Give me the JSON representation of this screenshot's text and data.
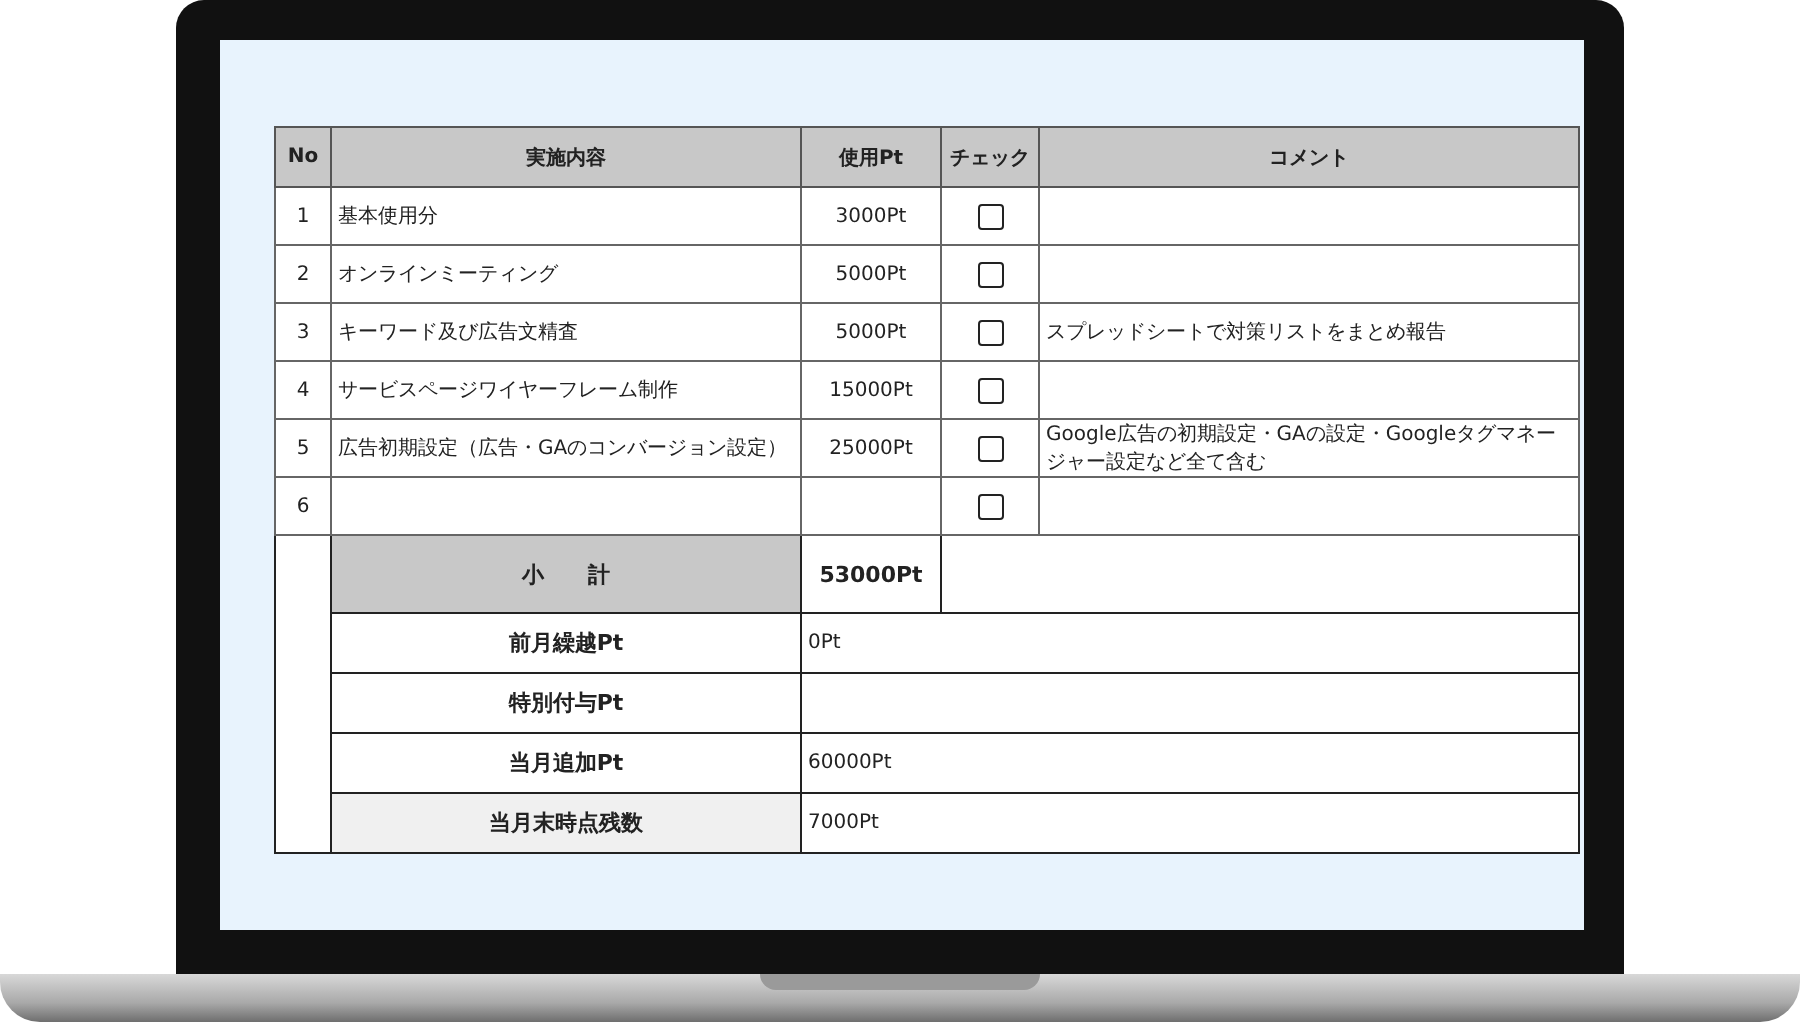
{
  "table": {
    "columns": [
      "No",
      "実施内容",
      "使用Pt",
      "チェック",
      "コメント"
    ],
    "rows": [
      {
        "no": "1",
        "item": "基本使用分",
        "points": "3000Pt",
        "checked": false
      },
      {
        "no": "2",
        "item": "オンラインミーティング",
        "points": "5000Pt",
        "checked": false
      },
      {
        "no": "3",
        "item": "キーワード及び広告文精査",
        "points": "5000Pt",
        "checked": false,
        "comment": "スプレッドシートで対策リストをまとめ報告"
      },
      {
        "no": "4",
        "item": "サービスページワイヤーフレーム制作",
        "points": "15000Pt",
        "checked": false
      },
      {
        "no": "5",
        "item": "広告初期設定（広告・GAのコンバージョン設定）",
        "points": "25000Pt",
        "checked": false,
        "comment": "Google広告の初期設定・GAの設定・Googleタグマネージャー設定など全て含む"
      },
      {
        "no": "6",
        "checked": false
      }
    ],
    "summary": [
      {
        "kind": "subtotal",
        "label": "小　　計",
        "value": "53000Pt"
      },
      {
        "kind": "line",
        "label": "前月繰越Pt",
        "value": "0Pt"
      },
      {
        "kind": "line",
        "label": "特別付与Pt"
      },
      {
        "kind": "line",
        "label": "当月追加Pt",
        "value": "60000Pt"
      },
      {
        "kind": "line",
        "label": "当月末時点残数",
        "value": "7000Pt",
        "highlighted": true
      }
    ]
  }
}
